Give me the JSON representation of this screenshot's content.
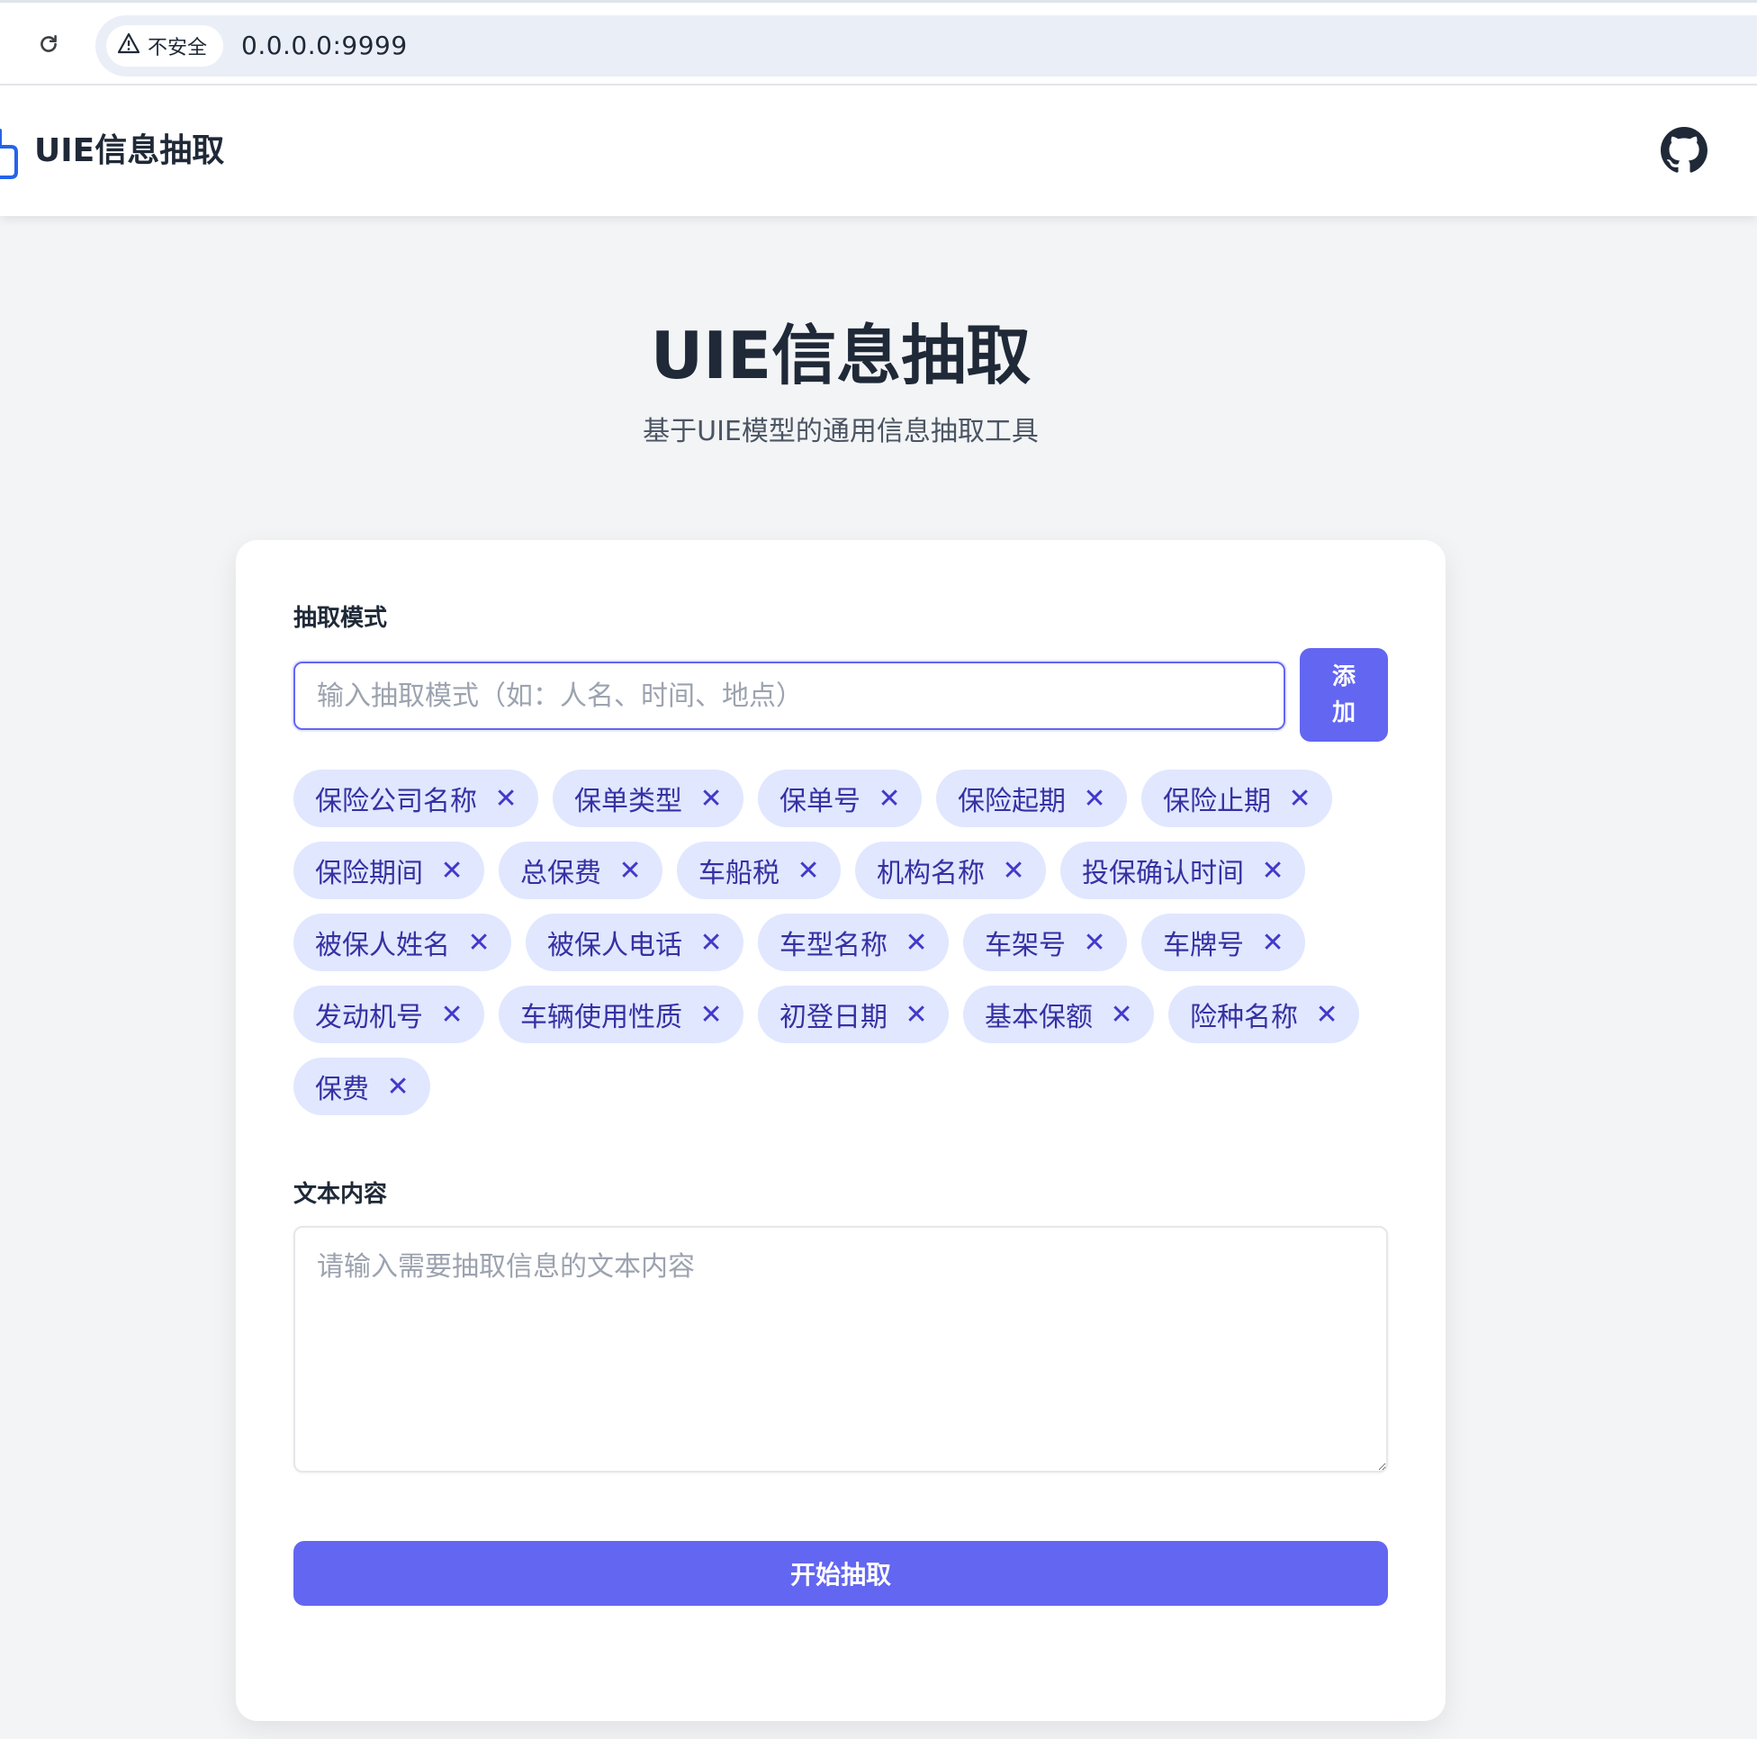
{
  "browser": {
    "security_label": "不安全",
    "url": "0.0.0.0:9999",
    "icons": [
      "reload-icon",
      "warning-icon"
    ]
  },
  "header": {
    "title": "UIE信息抽取",
    "icons": [
      "logo-icon",
      "github-icon"
    ]
  },
  "hero": {
    "title": "UIE信息抽取",
    "subtitle": "基于UIE模型的通用信息抽取工具"
  },
  "schema": {
    "label": "抽取模式",
    "placeholder": "输入抽取模式（如：人名、时间、地点）",
    "add_label": "添加",
    "remove_symbol": "✕",
    "tags": [
      "保险公司名称",
      "保单类型",
      "保单号",
      "保险起期",
      "保险止期",
      "保险期间",
      "总保费",
      "车船税",
      "机构名称",
      "投保确认时间",
      "被保人姓名",
      "被保人电话",
      "车型名称",
      "车架号",
      "车牌号",
      "发动机号",
      "车辆使用性质",
      "初登日期",
      "基本保额",
      "险种名称",
      "保费"
    ]
  },
  "text": {
    "label": "文本内容",
    "placeholder": "请输入需要抽取信息的文本内容"
  },
  "submit": {
    "label": "开始抽取"
  },
  "colors": {
    "accent": "#6366f1",
    "tag_bg": "#e0e7ff",
    "tag_text": "#3730a3",
    "page_bg": "#f3f4f6"
  }
}
